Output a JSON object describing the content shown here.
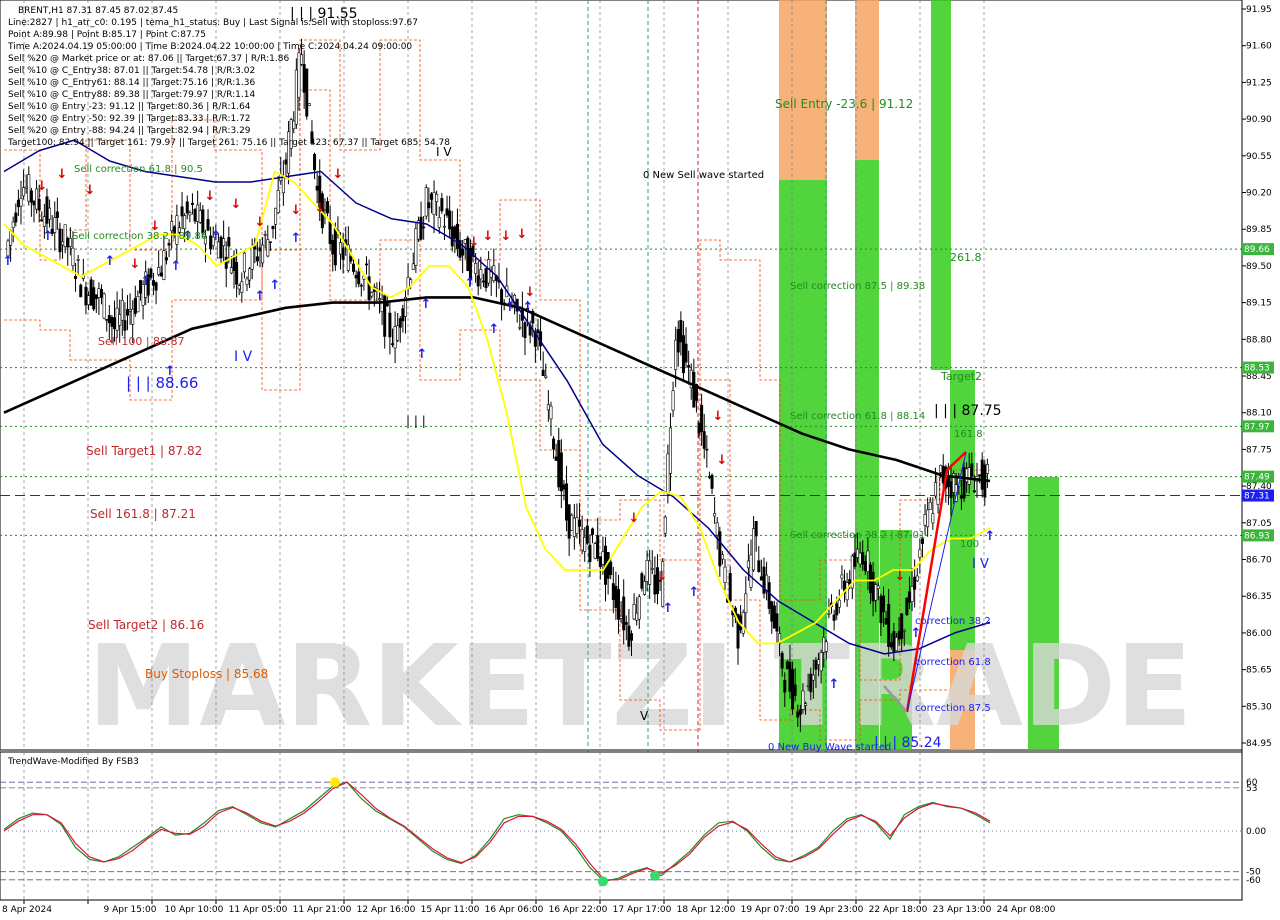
{
  "header": {
    "symbol_line": "BRENT,H1  87.31 87.45 87.02 87.45",
    "info_lines": [
      "Line:2827 | h1_atr_c0: 0.195 | tema_h1_status: Buy | Last Signal is:Sell with stoploss:97.67",
      "Point A:89.98 | Point B:85.17 | Point C:87.75",
      "Time A:2024.04.19 05:00:00 | Time B:2024.04.22 10:00:00 | Time C:2024.04.24 09:00:00",
      "Sell %20 @ Market price or at: 87.06 || Target:67.37 | R/R:1.86",
      "Sell %10 @ C_Entry38: 87.01 || Target:54.78 | R/R:3.02",
      "Sell %10 @ C_Entry61: 88.14 || Target:75.16 | R/R:1.36",
      "Sell %10 @ C_Entry88: 89.38 || Target:79.97 | R/R:1.14",
      "Sell %10 @ Entry -23: 91.12 || Target:80.36 | R/R:1.64",
      "Sell %20 @ Entry -50: 92.39 || Target:83.33 | R/R:1.72",
      "Sell %20 @ Entry -88: 94.24 || Target:82.94 | R/R:3.29",
      "Target100: 82.94 || Target 161: 79.97 || Target 261: 75.16 || Target 423: 67.37 || Target 685: 54.78"
    ]
  },
  "watermark": "MARKETZI TRADE",
  "colors": {
    "bg": "#ffffff",
    "grid": "#7a7a7a",
    "bull": "#000000",
    "yellow_ma": "#ffff00",
    "navy_ma": "#00008b",
    "black_ma": "#000000",
    "green_zone": "#33cc1a",
    "orange_zone": "#f4a460",
    "red_label": "#c0282d",
    "green_level": "#228b22",
    "blue_level": "#1e1ef0",
    "price_tag_green": "#3cb53c",
    "price_tag_blue": "#1e1ef0"
  },
  "chart_data": [
    {
      "type": "candlestick",
      "title": "BRENT,H1",
      "x_labels": [
        "8 Apr 2024",
        "9 Apr 15:00",
        "10 Apr 10:00",
        "11 Apr 05:00",
        "11 Apr 21:00",
        "12 Apr 16:00",
        "15 Apr 11:00",
        "16 Apr 06:00",
        "16 Apr 22:00",
        "17 Apr 17:00",
        "18 Apr 12:00",
        "19 Apr 07:00",
        "19 Apr 23:00",
        "22 Apr 18:00",
        "23 Apr 13:00",
        "24 Apr 08:00"
      ],
      "y_ticks": [
        "91.95",
        "91.60",
        "91.25",
        "90.90",
        "90.55",
        "90.20",
        "89.85",
        "89.50",
        "89.15",
        "88.80",
        "88.45",
        "88.10",
        "87.75",
        "87.40",
        "87.05",
        "86.70",
        "86.35",
        "86.00",
        "85.65",
        "85.30",
        "84.95"
      ],
      "ylim": [
        84.95,
        91.95
      ],
      "price_tags": [
        {
          "value": "89.66",
          "color": "#3cb53c"
        },
        {
          "value": "88.53",
          "color": "#3cb53c"
        },
        {
          "value": "87.97",
          "color": "#3cb53c"
        },
        {
          "value": "87.49",
          "color": "#3cb53c"
        },
        {
          "value": "87.31",
          "color": "#1e1ef0"
        },
        {
          "value": "86.93",
          "color": "#3cb53c"
        }
      ],
      "horizontal_levels": [
        {
          "value": 89.66,
          "style": "dotted-green"
        },
        {
          "value": 88.53,
          "style": "dotted-green"
        },
        {
          "value": 87.97,
          "style": "dotted-green"
        },
        {
          "value": 87.49,
          "style": "dotted-green"
        },
        {
          "value": 87.31,
          "style": "dashed-blue"
        },
        {
          "value": 86.93,
          "style": "dotted-green"
        }
      ],
      "annotations": [
        {
          "text": "| | | 91.55",
          "color": "#000000"
        },
        {
          "text": "Sell correction 61.8 | 90.5",
          "color": "#228b22"
        },
        {
          "text": "Sell correction 38.2 | 89.86",
          "color": "#228b22"
        },
        {
          "text": "Sell 100 | 88.87",
          "color": "#c0282d"
        },
        {
          "text": "| | | 88.66",
          "color": "#1e1ef0"
        },
        {
          "text": "Sell Target1 | 87.82",
          "color": "#c0282d"
        },
        {
          "text": "Sell 161.8 | 87.21",
          "color": "#c0282d"
        },
        {
          "text": "Sell Target2 | 86.16",
          "color": "#c0282d"
        },
        {
          "text": "Buy Stoploss | 85.68",
          "color": "#e05a00"
        },
        {
          "text": "0 New Sell wave started",
          "color": "#000000"
        },
        {
          "text": "Sell Entry -23.6 | 91.12",
          "color": "#228b22"
        },
        {
          "text": "Sell correction 87.5 | 89.38",
          "color": "#228b22"
        },
        {
          "text": "Sell correction 61.8 | 88.14",
          "color": "#228b22"
        },
        {
          "text": "Sell correction 38.2 | 87.01",
          "color": "#228b22"
        },
        {
          "text": "261.8",
          "color": "#228b22"
        },
        {
          "text": "Target2",
          "color": "#228b22"
        },
        {
          "text": "| | | 87.75",
          "color": "#000000"
        },
        {
          "text": "161.8",
          "color": "#228b22"
        },
        {
          "text": "100",
          "color": "#228b22"
        },
        {
          "text": "correction 38.2",
          "color": "#1e1ef0"
        },
        {
          "text": "correction 61.8",
          "color": "#1e1ef0"
        },
        {
          "text": "correction 87.5",
          "color": "#1e1ef0"
        },
        {
          "text": "| | | 85.24",
          "color": "#1e1ef0"
        },
        {
          "text": "0 New Buy Wave started",
          "color": "#1e1ef0"
        },
        {
          "text": "I V",
          "color": "#000000"
        },
        {
          "text": "I V",
          "color": "#1e1ef0"
        },
        {
          "text": "I V",
          "color": "#1e1ef0"
        },
        {
          "text": "V",
          "color": "#000000"
        },
        {
          "text": "| | |",
          "color": "#000000"
        }
      ],
      "series": [
        {
          "name": "",
          "kind": "price",
          "values": [
            89.6,
            90.3,
            90.1,
            89.9,
            89.7,
            89.3,
            89.2,
            88.9,
            89.1,
            89.3,
            89.5,
            89.9,
            90.0,
            89.8,
            89.7,
            89.4,
            89.6,
            89.8,
            90.5,
            91.55,
            90.2,
            89.7,
            89.6,
            89.4,
            89.1,
            88.8,
            89.5,
            90.1,
            90.0,
            89.7,
            89.5,
            89.4,
            89.2,
            89.0,
            88.9,
            88.0,
            87.1,
            86.9,
            86.8,
            86.4,
            86.0,
            86.6,
            86.4,
            88.9,
            88.4,
            87.6,
            86.6,
            86.0,
            86.9,
            86.3,
            85.6,
            85.3,
            85.7,
            86.2,
            86.5,
            86.8,
            86.3,
            85.9,
            86.3,
            87.0,
            87.5,
            87.4,
            87.5,
            87.45
          ]
        },
        {
          "name": "",
          "kind": "ma-yellow",
          "values": [
            89.9,
            89.7,
            89.6,
            89.5,
            89.4,
            89.5,
            89.6,
            89.7,
            89.8,
            89.8,
            89.7,
            89.5,
            89.6,
            89.7,
            90.4,
            90.3,
            90.1,
            89.9,
            89.6,
            89.3,
            89.2,
            89.3,
            89.5,
            89.5,
            89.3,
            88.8,
            88.1,
            87.2,
            86.8,
            86.6,
            86.6,
            86.6,
            86.9,
            87.2,
            87.35,
            87.3,
            87.0,
            86.5,
            86.1,
            85.9,
            85.9,
            86.0,
            86.1,
            86.3,
            86.5,
            86.5,
            86.6,
            86.6,
            86.8,
            86.9,
            86.9,
            87.0
          ]
        },
        {
          "name": "",
          "kind": "ma-navy",
          "values": [
            90.4,
            90.6,
            90.7,
            90.5,
            90.4,
            90.35,
            90.3,
            90.3,
            90.35,
            90.4,
            90.1,
            89.95,
            89.9,
            89.7,
            89.4,
            88.9,
            88.4,
            87.8,
            87.5,
            87.3,
            87.0,
            86.6,
            86.3,
            86.1,
            85.9,
            85.8,
            85.85,
            86.0,
            86.1
          ]
        },
        {
          "name": "",
          "kind": "ma-black",
          "values": [
            88.1,
            88.3,
            88.5,
            88.7,
            88.9,
            89.0,
            89.1,
            89.15,
            89.15,
            89.2,
            89.2,
            89.1,
            88.9,
            88.7,
            88.5,
            88.3,
            88.1,
            87.9,
            87.75,
            87.65,
            87.5,
            87.45
          ]
        }
      ]
    },
    {
      "type": "line",
      "title": "TrendWave-Modified By FSB3",
      "y_ticks": [
        "60",
        "53",
        "0.00",
        "-50",
        "-60"
      ],
      "ylim": [
        -75,
        75
      ],
      "series": [
        {
          "name": "",
          "color": "#228b22",
          "values": [
            2,
            15,
            22,
            20,
            8,
            -20,
            -35,
            -38,
            -32,
            -20,
            -8,
            5,
            -5,
            -3,
            10,
            25,
            30,
            20,
            10,
            5,
            15,
            25,
            40,
            55,
            60,
            40,
            25,
            15,
            5,
            -10,
            -25,
            -35,
            -40,
            -30,
            -10,
            15,
            20,
            18,
            10,
            0,
            -20,
            -45,
            -62,
            -58,
            -50,
            -45,
            -55,
            -40,
            -25,
            -5,
            10,
            12,
            0,
            -20,
            -35,
            -38,
            -30,
            -20,
            0,
            15,
            20,
            10,
            -10,
            20,
            30,
            35,
            30,
            28,
            20,
            10
          ]
        },
        {
          "name": "",
          "color": "#dc143c",
          "values": [
            0,
            12,
            20,
            20,
            10,
            -15,
            -32,
            -38,
            -34,
            -24,
            -10,
            2,
            -3,
            -4,
            6,
            22,
            29,
            22,
            12,
            6,
            12,
            22,
            36,
            52,
            60,
            45,
            28,
            16,
            6,
            -8,
            -22,
            -33,
            -39,
            -32,
            -14,
            10,
            18,
            18,
            12,
            2,
            -16,
            -40,
            -60,
            -60,
            -52,
            -46,
            -52,
            -42,
            -28,
            -8,
            6,
            11,
            2,
            -16,
            -32,
            -38,
            -32,
            -22,
            -4,
            12,
            19,
            12,
            -6,
            16,
            28,
            34,
            31,
            28,
            22,
            12
          ]
        }
      ],
      "markers": [
        {
          "color": "#ffeb00",
          "value": 60
        },
        {
          "color": "#33dd66",
          "value": -62
        },
        {
          "color": "#33dd66",
          "value": -55
        }
      ]
    }
  ]
}
